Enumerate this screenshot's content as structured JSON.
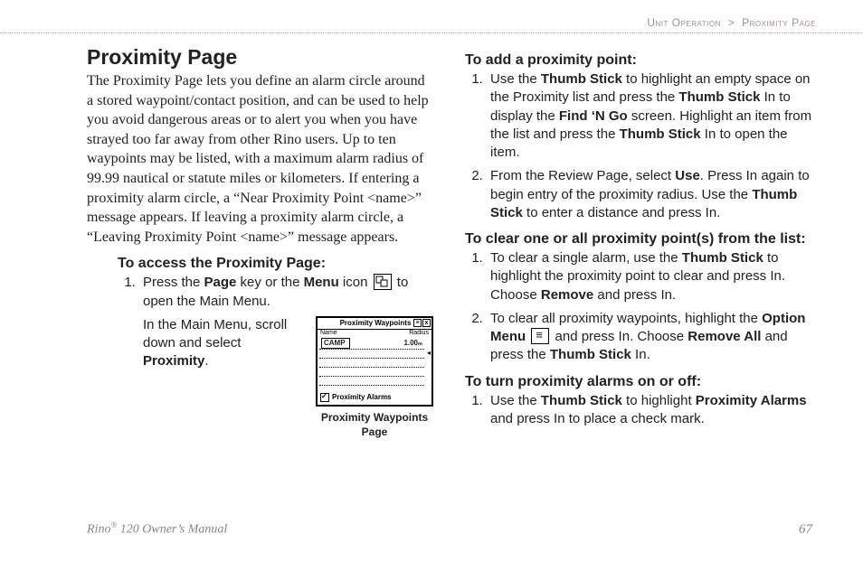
{
  "breadcrumb": {
    "section": "Unit Operation",
    "page": "Proximity Page",
    "sep": ">"
  },
  "title": "Proximity Page",
  "intro": "The Proximity Page lets you define an alarm circle around a stored waypoint/contact position, and can be used to help you avoid dangerous areas or to alert you when you have strayed too far away from other Rino users. Up to ten waypoints may be listed, with a maximum alarm radius of 99.99 nautical or statute miles or kilometers. If entering a proximity alarm circle, a “Near Proximity Point <name>” message appears. If leaving a proximity alarm circle, a “Leaving Proximity Point <name>” message appears.",
  "access": {
    "heading": "To access the Proximity Page:",
    "step1_a": "Press the ",
    "step1_b": "Page",
    "step1_c": " key or the ",
    "step1_d": "Menu",
    "step1_e": " icon ",
    "step1_f": " to open the Main Menu.",
    "step2_a": "In the Main Menu, scroll down and select ",
    "step2_b": "Proximity",
    "step2_c": "."
  },
  "figure": {
    "titlebar": "Proximity Waypoints",
    "col1": "Name",
    "col2": "Radius",
    "row1_name": "CAMP",
    "row1_val": "1.00ₘ",
    "checkbox": "Proximity Alarms",
    "caption": "Proximity Waypoints Page"
  },
  "add": {
    "heading": "To add a proximity point:",
    "s1_a": "Use the ",
    "s1_b": "Thumb Stick",
    "s1_c": " to highlight an empty space on the Proximity list and press the ",
    "s1_d": "Thumb Stick",
    "s1_e": " In to display the ",
    "s1_f": "Find ‘N Go",
    "s1_g": " screen. Highlight an item from the list and press the ",
    "s1_h": "Thumb Stick",
    "s1_i": " In to open the item.",
    "s2_a": "From the Review Page, select ",
    "s2_b": "Use",
    "s2_c": ". Press In again to begin entry of the proximity radius. Use the ",
    "s2_d": "Thumb Stick",
    "s2_e": " to enter a distance and press In."
  },
  "clear": {
    "heading": "To clear one or all proximity point(s) from the list:",
    "s1_a": "To clear a single alarm, use the ",
    "s1_b": "Thumb Stick",
    "s1_c": " to highlight the proximity point to clear and press In. Choose ",
    "s1_d": "Remove",
    "s1_e": " and press In.",
    "s2_a": "To clear all proximity waypoints, highlight the ",
    "s2_b": "Option Menu",
    "s2_c": " ",
    "s2_d": " and press In. Choose ",
    "s2_e": "Remove All",
    "s2_f": " and press the ",
    "s2_g": "Thumb Stick",
    "s2_h": " In."
  },
  "toggle": {
    "heading": "To turn proximity alarms on or off:",
    "s1_a": "Use the ",
    "s1_b": "Thumb Stick",
    "s1_c": " to highlight ",
    "s1_d": "Proximity Alarms",
    "s1_e": " and press In to place a check mark."
  },
  "footer": {
    "product": "Rino",
    "model": " 120 Owner’s Manual",
    "pagenum": "67"
  }
}
